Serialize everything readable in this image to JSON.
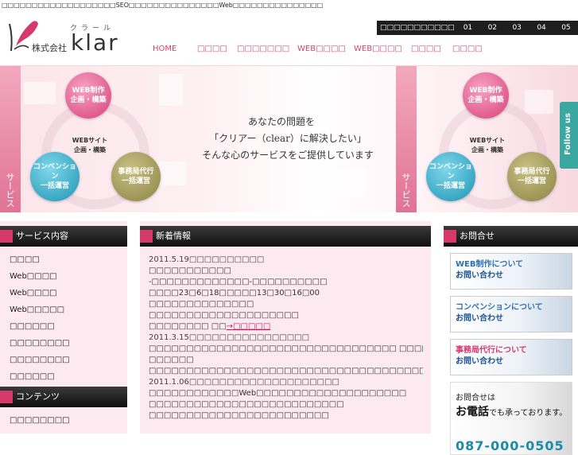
{
  "top_strip": "□□□□□□□□□□□□□□□□□□□SEO□□□□□□□□□□□□□□□Web□□□□□□□□□□□□□□□",
  "header": {
    "logo_kana": "クラール",
    "logo_company": "株式会社",
    "logo_en": "klar",
    "subnav_label": "□□□□□□□□□□□",
    "subnav_numbers": [
      "01",
      "02",
      "03",
      "04",
      "05"
    ],
    "nav": [
      "HOME",
      "□□□□",
      "□□□□□□□",
      "WEB□□□□",
      "WEB□□□□",
      "□□□□",
      "□□□□"
    ]
  },
  "hero": {
    "web_circle": [
      "WEB制作",
      "企画・構築"
    ],
    "center": [
      "WEBサイト",
      "企画・構築"
    ],
    "conv_circle": [
      "コンベンション",
      "一括運営"
    ],
    "office_circle": [
      "事務局代行",
      "一括運営"
    ],
    "side_label": "サービス",
    "tagline": [
      "あなたの問題を",
      "「クリアー（clear）に解決したい」",
      "そんな心のサービスをご提供しています"
    ],
    "follow": "Follow us"
  },
  "left": {
    "services_title": "サービス内容",
    "services": [
      "□□□□",
      "Web□□□□",
      "Web□□□□",
      "Web□□□□□",
      "□□□□□□",
      "□□□□□□□□",
      "□□□□□□□□",
      "□□□□□□"
    ],
    "contents_title": "コンテンツ",
    "contents": [
      "□□□□□□□□"
    ]
  },
  "news": {
    "title": "新着情報",
    "lines": [
      {
        "text": "2011.5.19□□□□□□□□□□",
        "cls": "date"
      },
      {
        "text": "□□□□□□□□□□□",
        "cls": ""
      },
      {
        "text": "-□□□□□□□□□□□□□-□□□□□□□□□□",
        "cls": ""
      },
      {
        "text": "□□□□23□6□18□□□□□13□30□16□00",
        "cls": ""
      },
      {
        "text": "□□□□□□□□□□□□□□",
        "cls": ""
      },
      {
        "text": "□□□□□□□□□□□□□□□□□□□□",
        "cls": ""
      },
      {
        "text": "□□□□□□□□ □□",
        "cls": "",
        "link": "→□□□□□"
      },
      {
        "text": "2011.3.15□□□□□□□□□□□□□□□□",
        "cls": "date"
      },
      {
        "text": "□□□□□□□□□□□□□□□□□□□□□□□□□□□□□□□□□ □□□□□□□□□□□□□□□□",
        "cls": ""
      },
      {
        "text": "□□□□□□",
        "cls": ""
      },
      {
        "text": "□□□□□□□□□□□□□□□□□□□□□□□□□□□□□□□□□□□□□□□□□□□□□□□□□□□",
        "cls": ""
      },
      {
        "text": "2011.1.06□□□□□□□□□□□□□□□□□□□□",
        "cls": "date"
      },
      {
        "text": "□□□□□□□□□□□□Web□□□□□□□□□□□□□□□□□□□□",
        "cls": ""
      },
      {
        "text": "□□□□□□□□□□□□□□□□□□□□□□□□□□",
        "cls": ""
      },
      {
        "text": "□□□□□□□□□□□□□□□□□□□□□□□□",
        "cls": ""
      }
    ]
  },
  "contact": {
    "title": "お問合せ",
    "banners": [
      [
        "WEB制作について",
        "お問い合わせ"
      ],
      [
        "コンベンションについて",
        "お問い合わせ"
      ],
      [
        "事務局代行について",
        "お問い合わせ"
      ]
    ],
    "phone_small": "お問合せは",
    "phone_big": "お電話",
    "phone_rest": "でも承っております。",
    "phone_number": "087-000-0505"
  }
}
